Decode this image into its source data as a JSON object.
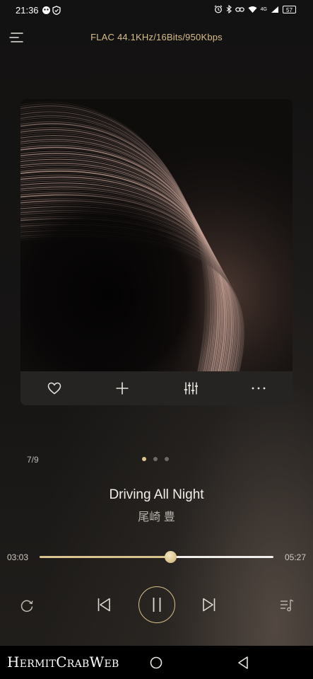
{
  "status_bar": {
    "time": "21:36",
    "network": "4G",
    "battery": "57"
  },
  "header": {
    "format_info": "FLAC 44.1KHz/16Bits/950Kbps",
    "menu_icon": "menu-icon"
  },
  "album": {
    "art": "feather-closeup",
    "actions": [
      {
        "icon": "heart-icon"
      },
      {
        "icon": "plus-icon"
      },
      {
        "icon": "equalizer-icon"
      },
      {
        "icon": "more-icon"
      }
    ]
  },
  "track": {
    "index": "7/9",
    "pager": {
      "pages": 3,
      "active": 0
    },
    "title": "Driving All Night",
    "artist": "尾崎 豊"
  },
  "progress": {
    "elapsed": "03:03",
    "total": "05:27",
    "fraction": 0.56
  },
  "controls": {
    "repeat_icon": "repeat-icon",
    "prev_icon": "skip-previous-icon",
    "pause_icon": "pause-icon",
    "next_icon": "skip-next-icon",
    "queue_icon": "playlist-icon"
  },
  "nav": {
    "watermark": "HermitCrabWeb"
  },
  "colors": {
    "accent": "#d7bd86",
    "background": "#151413"
  }
}
